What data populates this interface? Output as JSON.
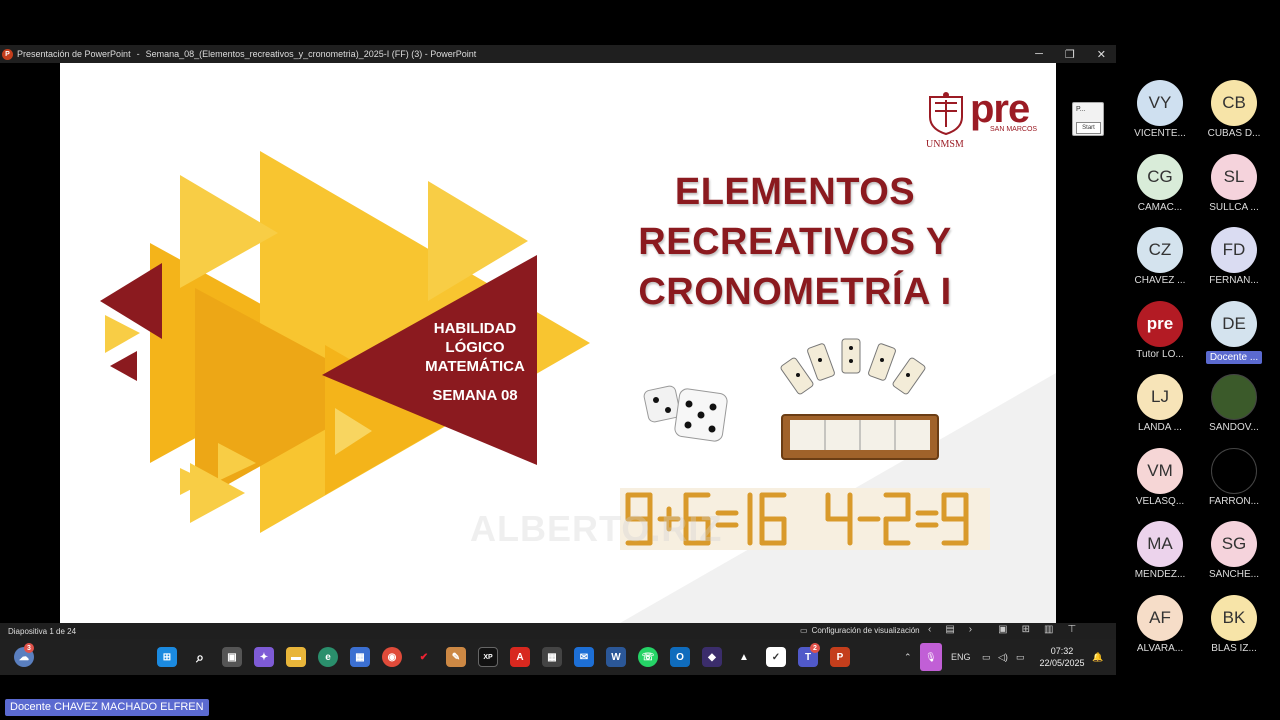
{
  "window": {
    "app_title": "Presentación de PowerPoint",
    "document_title": "Semana_08_(Elementos_recreativos_y_cronometria)_2025-I (FF) (3) - PowerPoint"
  },
  "slide": {
    "title_lines": [
      "ELEMENTOS",
      "RECREATIVOS Y",
      "CRONOMETRÍA I"
    ],
    "subject_lines": [
      "HABILIDAD",
      "LÓGICO",
      "MATEMÁTICA"
    ],
    "week": "SEMANA 08",
    "logo": {
      "pre": "pre",
      "san_marcos": "SAN MARCOS",
      "unmsm": "UNMSM"
    },
    "watermark": "ALBERTO.RIZ",
    "colors": {
      "maroon": "#8b1a1f",
      "gold": "#f4b41a",
      "gold_light": "#f8cd45"
    },
    "matchstick_equations": [
      "9+6=16",
      "4-2=9"
    ]
  },
  "status_bar": {
    "slide_count": "Diapositiva 1 de 24",
    "view_config": "Configuración de visualización"
  },
  "taskbar": {
    "weather_badge": "3",
    "teams_badge": "2",
    "language": "ENG",
    "time": "07:32",
    "date": "22/05/2025"
  },
  "start_popup": {
    "label": "P...",
    "button": "Start"
  },
  "participants": [
    {
      "initials": "VY",
      "name": "VICENTE...",
      "color": "#cfe0f0"
    },
    {
      "initials": "CB",
      "name": "CUBAS D...",
      "color": "#f7e4a8"
    },
    {
      "initials": "CG",
      "name": "CAMAC...",
      "color": "#d9ecd9"
    },
    {
      "initials": "SL",
      "name": "SULLCA ...",
      "color": "#f5d3dc"
    },
    {
      "initials": "CZ",
      "name": "CHAVEZ ...",
      "color": "#d4e3ee"
    },
    {
      "initials": "FD",
      "name": "FERNAN...",
      "color": "#dadcf2"
    },
    {
      "initials": "",
      "name": "Tutor LO...",
      "color": "#b31b24"
    },
    {
      "initials": "DE",
      "name": "Docente ...",
      "color": "#d4e3ee"
    },
    {
      "initials": "LJ",
      "name": "LANDA ...",
      "color": "#f7e4b8"
    },
    {
      "initials": "",
      "name": "SANDOV...",
      "color": "#3b5a2a"
    },
    {
      "initials": "VM",
      "name": "VELASQ...",
      "color": "#f6d6d6"
    },
    {
      "initials": "",
      "name": "FARRON...",
      "color": "#000000"
    },
    {
      "initials": "MA",
      "name": "MENDEZ...",
      "color": "#ecd3ec"
    },
    {
      "initials": "SG",
      "name": "SÁNCHE...",
      "color": "#f5d3dc"
    },
    {
      "initials": "AF",
      "name": "ALVARA...",
      "color": "#f6ddc8"
    },
    {
      "initials": "BK",
      "name": "BLAS IZ...",
      "color": "#f7e4a8"
    }
  ],
  "active_speaker": "Docente CHAVEZ MACHADO ELFREN"
}
